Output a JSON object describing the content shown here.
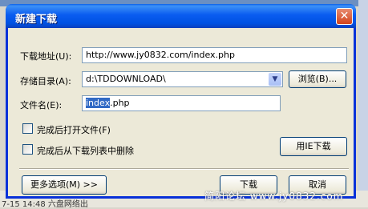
{
  "window": {
    "title": "新建下载",
    "close_glyph": "✕"
  },
  "form": {
    "url_label": "下载地址(U):",
    "url_value": "http://www.jy0832.com/index.php",
    "dir_label": "存储目录(A):",
    "dir_value": "d:\\TDDOWNLOAD\\",
    "browse_label": "浏览(B)...",
    "filename_label": "文件名(E):",
    "filename_selected": "index",
    "filename_rest": ".php"
  },
  "options": {
    "open_after": "完成后打开文件(F)",
    "remove_after": "完成后从下载列表中删除",
    "ie_download": "用IE下载"
  },
  "footer": {
    "more_options": "更多选项(M) >>",
    "download": "下载",
    "cancel": "取消"
  },
  "background": {
    "bottom_text": "7-15 14:48 六盘网络出",
    "watermark": "简阳论坛 www.jy0832.com"
  }
}
